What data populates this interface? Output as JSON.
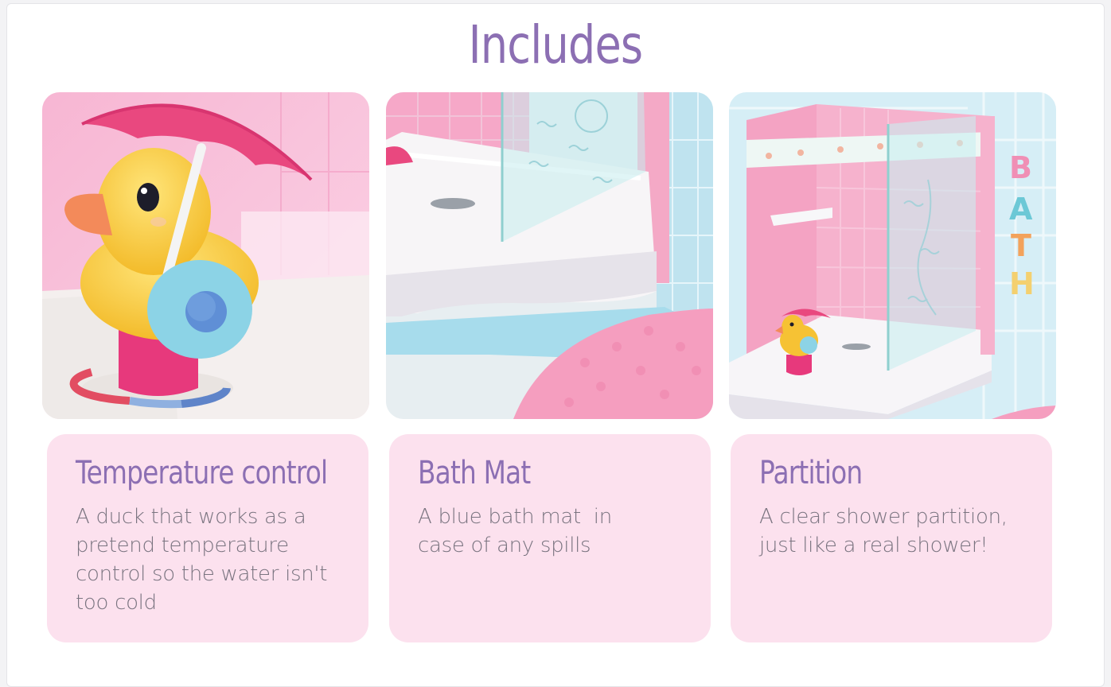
{
  "page": {
    "title": "Includes"
  },
  "features": [
    {
      "heading": "Temperature control",
      "description": "A duck that works as a pretend temperature control so the water isn't too cold"
    },
    {
      "heading": "Bath Mat",
      "description": "A blue bath mat  in case of any spills"
    },
    {
      "heading": "Partition",
      "description": "A clear shower partition, just like a real shower!"
    }
  ],
  "wall_letters": [
    "B",
    "A",
    "T",
    "H"
  ],
  "colors": {
    "accent_purple": "#8c6fb3",
    "card_pink": "#fce1ee",
    "body_text": "#7a7480"
  }
}
